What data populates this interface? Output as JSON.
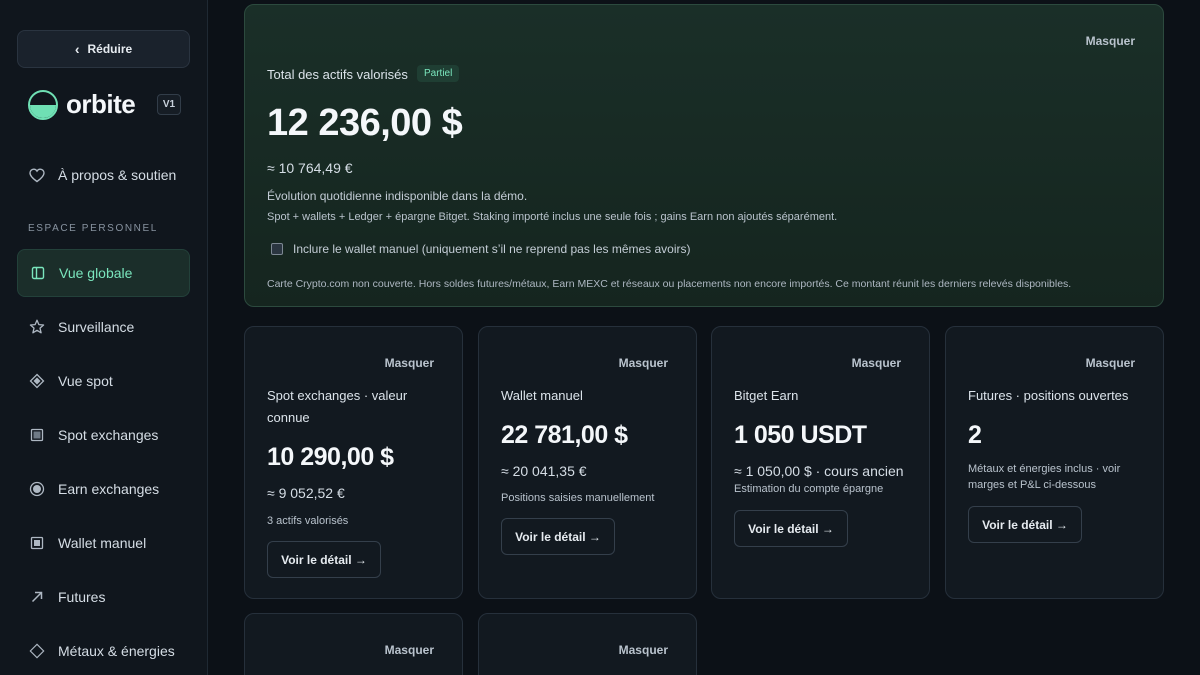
{
  "sidebar": {
    "collapse_label": "Réduire",
    "brand": "orbite",
    "version": "V1",
    "about": "À propos & soutien",
    "section_label": "ESPACE PERSONNEL",
    "items": [
      {
        "label": "Vue globale",
        "icon": "layout-icon",
        "active": true
      },
      {
        "label": "Surveillance",
        "icon": "star-icon"
      },
      {
        "label": "Vue spot",
        "icon": "diamond-icon"
      },
      {
        "label": "Spot exchanges",
        "icon": "square-grid-icon"
      },
      {
        "label": "Earn exchanges",
        "icon": "circle-icon"
      },
      {
        "label": "Wallet manuel",
        "icon": "wallet-icon"
      },
      {
        "label": "Futures",
        "icon": "arrow-up-right-icon"
      },
      {
        "label": "Métaux & énergies",
        "icon": "diamond-outline-icon"
      }
    ]
  },
  "hero": {
    "hide_label": "Masquer",
    "title": "Total des actifs valorisés",
    "badge": "Partiel",
    "amount": "12 236,00 $",
    "eur": "≈ 10 764,49 €",
    "evolution": "Évolution quotidienne indisponible dans la démo.",
    "sources": "Spot + wallets + Ledger + épargne Bitget. Staking importé inclus une seule fois ; gains Earn non ajoutés séparément.",
    "checkbox_label": "Inclure le wallet manuel (uniquement s’il ne reprend pas les mêmes avoirs)",
    "checkbox_checked": false,
    "note": "Carte Crypto.com non couverte. Hors soldes futures/métaux, Earn MEXC et réseaux ou placements non encore importés. Ce montant réunit les derniers relevés disponibles."
  },
  "cards": [
    {
      "hide_label": "Masquer",
      "title": "Spot exchanges · valeur connue",
      "amount": "10 290,00 $",
      "sub": "≈ 9 052,52 €",
      "note": "3 actifs valorisés",
      "button": "Voir le détail →"
    },
    {
      "hide_label": "Masquer",
      "title": "Wallet manuel",
      "amount": "22 781,00 $",
      "sub": "≈ 20 041,35 €",
      "note": "Positions saisies manuellement",
      "button": "Voir le détail →"
    },
    {
      "hide_label": "Masquer",
      "title": "Bitget Earn",
      "amount": "1 050 USDT",
      "sub": "≈ 1 050,00 $ · cours ancien",
      "note": "Estimation du compte épargne",
      "button": "Voir le détail →"
    },
    {
      "hide_label": "Masquer",
      "title": "Futures · positions ouvertes",
      "amount": "2",
      "note": "Métaux et énergies inclus · voir marges et P&L ci-dessous",
      "button": "Voir le détail →"
    }
  ],
  "bottom_cards": [
    {
      "hide_label": "Masquer"
    },
    {
      "hide_label": "Masquer"
    }
  ],
  "colors": {
    "accent": "#7ae6bd",
    "background": "#0c1117",
    "card": "#121920",
    "hero": "#1a2f28"
  }
}
